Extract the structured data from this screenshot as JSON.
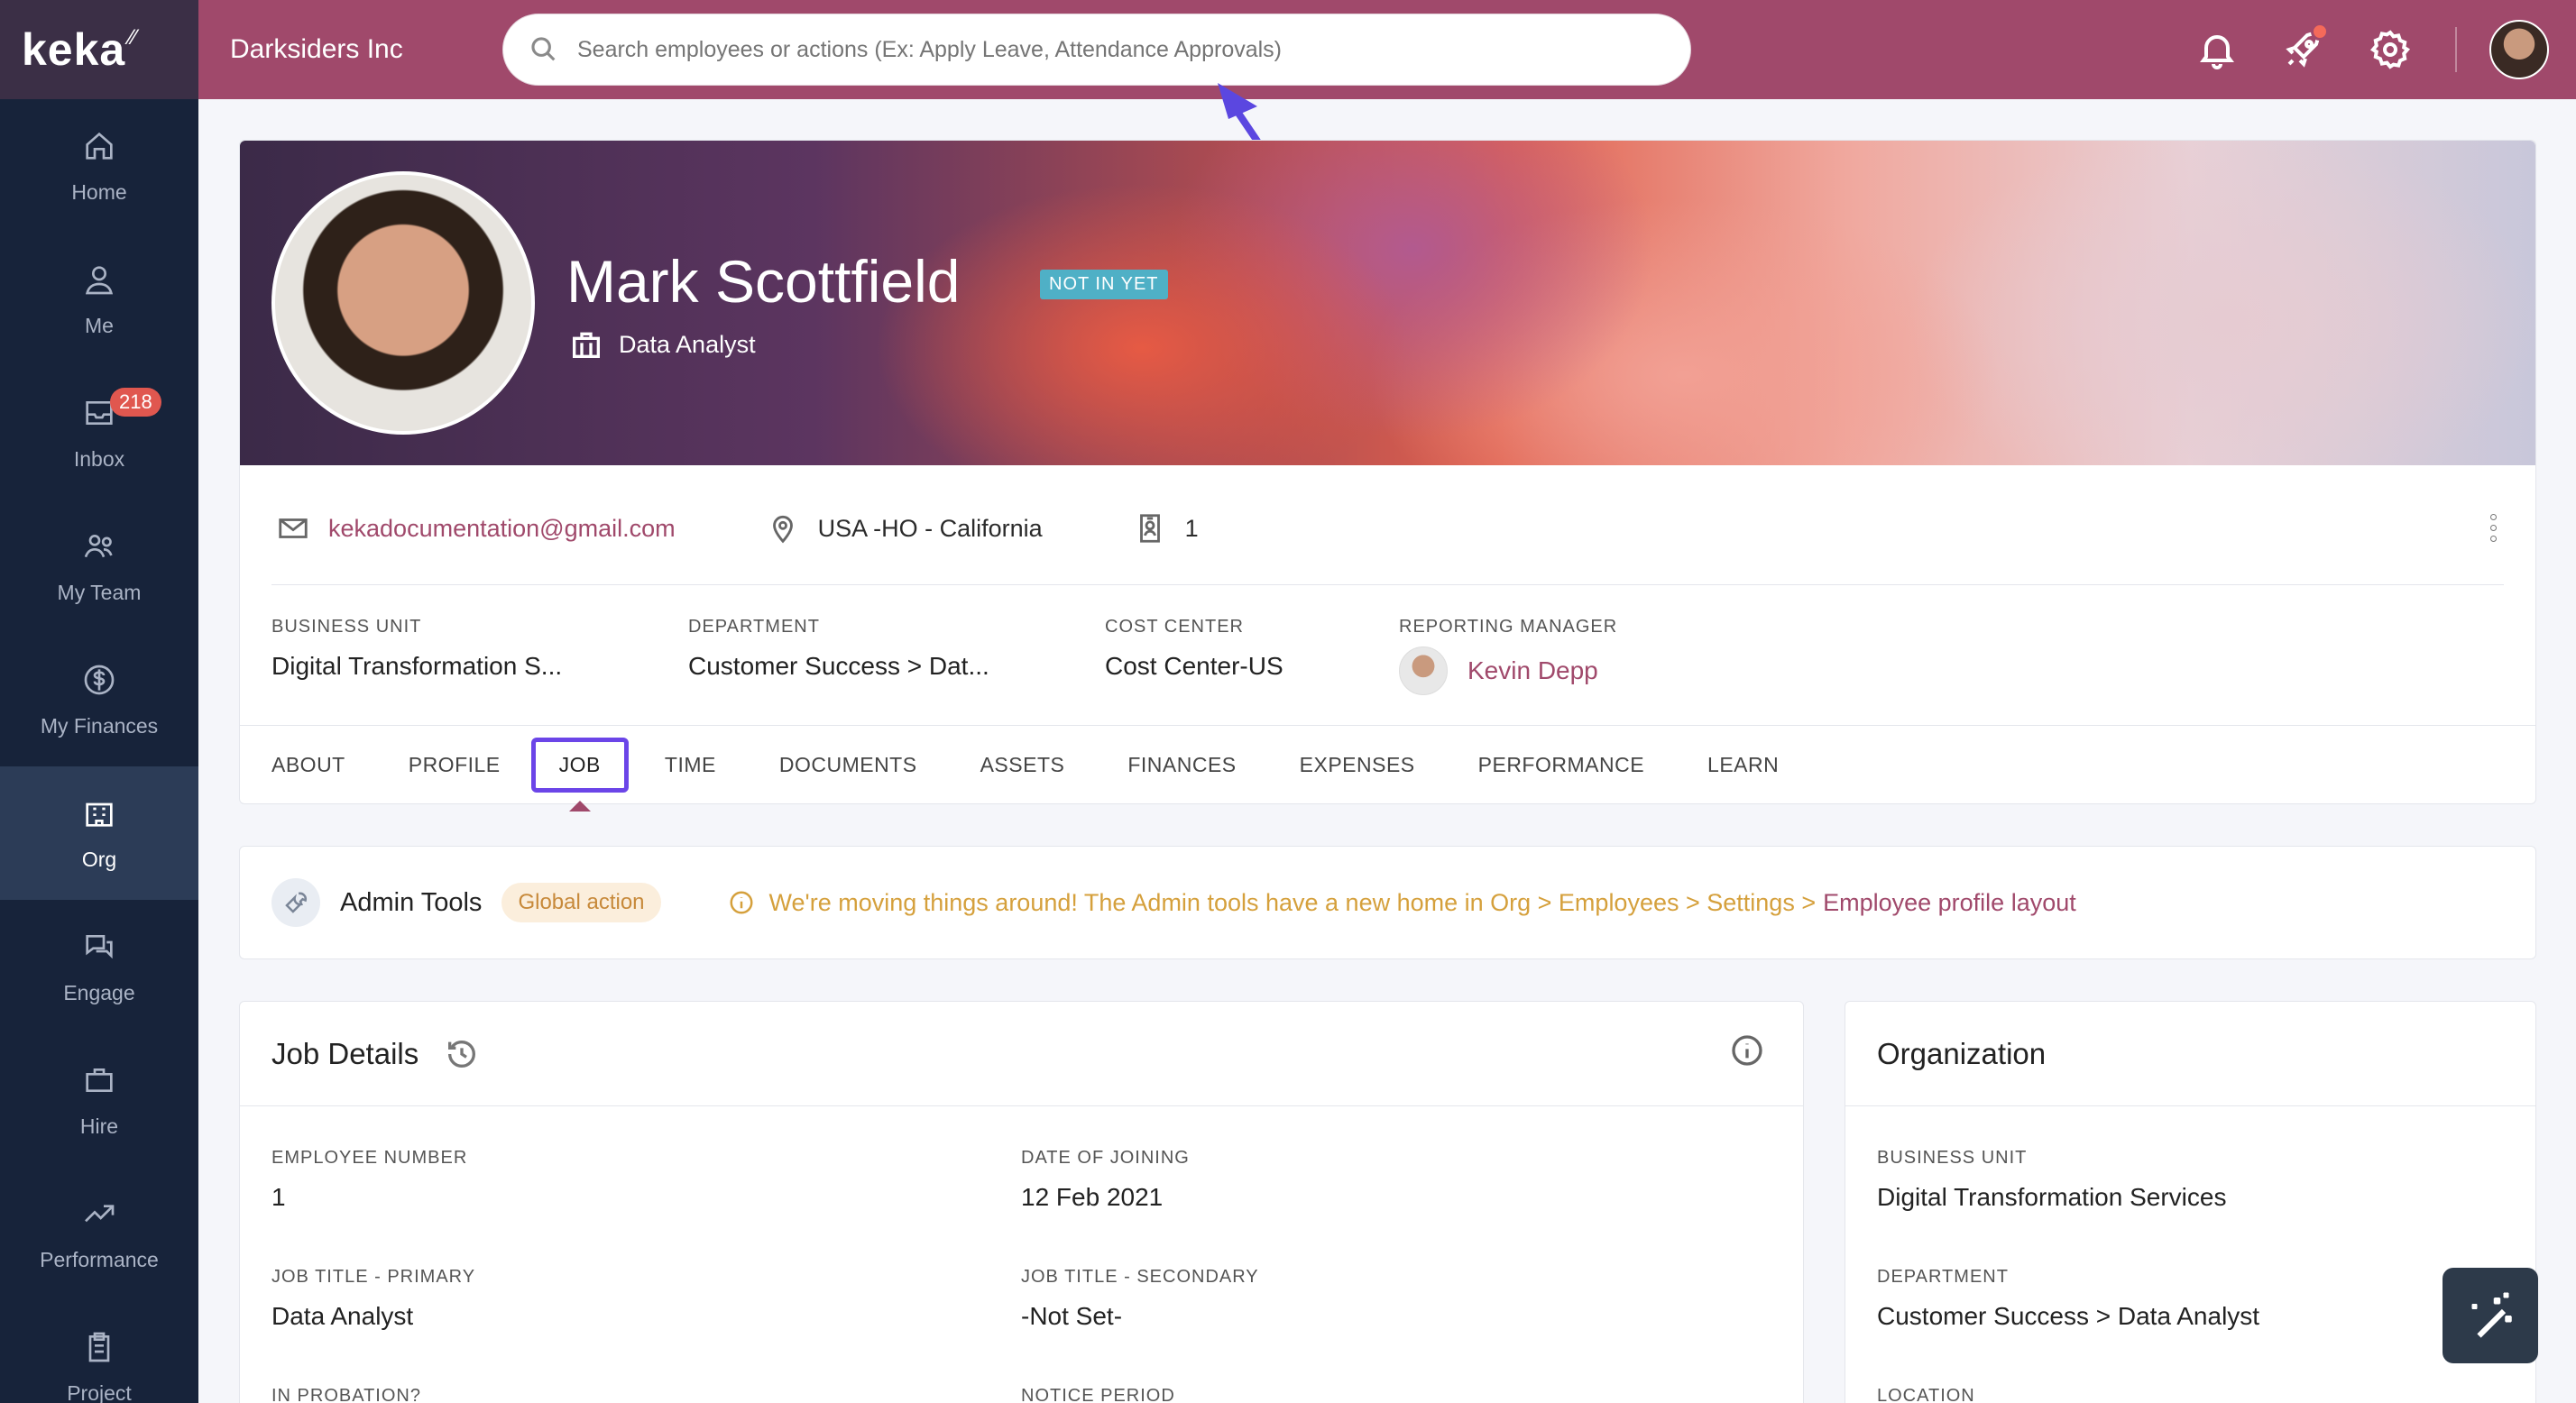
{
  "app": {
    "logo": "keka",
    "company": "Darksiders Inc"
  },
  "search": {
    "placeholder": "Search employees or actions (Ex: Apply Leave, Attendance Approvals)"
  },
  "sidebar": {
    "items": [
      {
        "label": "Home",
        "icon": "home-icon"
      },
      {
        "label": "Me",
        "icon": "user-icon"
      },
      {
        "label": "Inbox",
        "icon": "inbox-icon",
        "badge": "218"
      },
      {
        "label": "My Team",
        "icon": "team-icon"
      },
      {
        "label": "My Finances",
        "icon": "dollar-icon"
      },
      {
        "label": "Org",
        "icon": "building-icon",
        "active": true
      },
      {
        "label": "Engage",
        "icon": "chat-icon"
      },
      {
        "label": "Hire",
        "icon": "briefcase-icon"
      },
      {
        "label": "Performance",
        "icon": "trend-icon"
      },
      {
        "label": "Project",
        "icon": "clipboard-icon"
      }
    ]
  },
  "profile": {
    "name": "Mark Scottfield",
    "status": "NOT IN YET",
    "designation": "Data Analyst",
    "email": "kekadocumentation@gmail.com",
    "location": "USA -HO - California",
    "employee_id": "1",
    "business_unit_label": "BUSINESS UNIT",
    "business_unit": "Digital Transformation S...",
    "department_label": "DEPARTMENT",
    "department": "Customer Success > Dat...",
    "cost_center_label": "COST CENTER",
    "cost_center": "Cost Center-US",
    "reporting_manager_label": "REPORTING MANAGER",
    "reporting_manager": "Kevin Depp"
  },
  "tabs": [
    "ABOUT",
    "PROFILE",
    "JOB",
    "TIME",
    "DOCUMENTS",
    "ASSETS",
    "FINANCES",
    "EXPENSES",
    "PERFORMANCE",
    "LEARN"
  ],
  "active_tab": "JOB",
  "admin": {
    "title": "Admin Tools",
    "pill": "Global action",
    "notice": "We're moving things around! The Admin tools have a new home in Org > Employees > Settings >",
    "notice_link": "Employee profile layout"
  },
  "job_details": {
    "title": "Job Details",
    "employee_number_label": "EMPLOYEE NUMBER",
    "employee_number": "1",
    "date_of_joining_label": "DATE OF JOINING",
    "date_of_joining": "12 Feb 2021",
    "job_title_primary_label": "JOB TITLE - PRIMARY",
    "job_title_primary": "Data Analyst",
    "job_title_secondary_label": "JOB TITLE - SECONDARY",
    "job_title_secondary": "-Not Set-",
    "in_probation_label": "IN PROBATION?",
    "notice_period_label": "NOTICE PERIOD"
  },
  "organization": {
    "title": "Organization",
    "business_unit_label": "BUSINESS UNIT",
    "business_unit": "Digital Transformation Services",
    "department_label": "DEPARTMENT",
    "department": "Customer Success > Data Analyst",
    "location_label": "LOCATION"
  },
  "colors": {
    "brand": "#a0496b",
    "sidebar": "#17233a",
    "highlight": "#6b45e8",
    "status": "#4fb0c6"
  }
}
